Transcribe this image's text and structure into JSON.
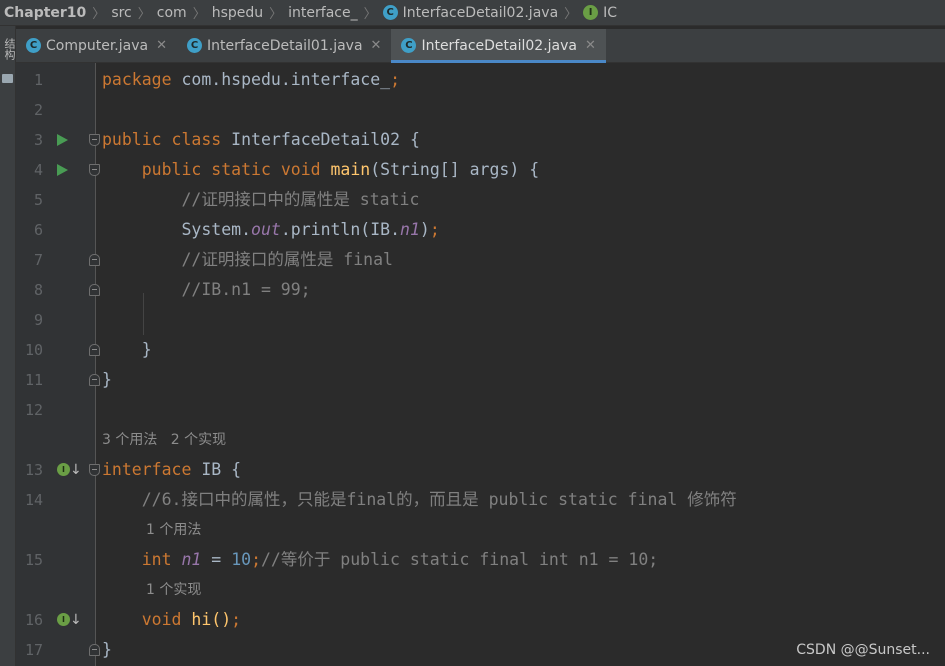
{
  "breadcrumb": [
    "Chapter10",
    "src",
    "com",
    "hspedu",
    "interface_",
    "InterfaceDetail02.java",
    "IC"
  ],
  "strip": {
    "label": "结构"
  },
  "tabs": [
    {
      "label": "Computer.java",
      "active": false
    },
    {
      "label": "InterfaceDetail01.java",
      "active": false
    },
    {
      "label": "InterfaceDetail02.java",
      "active": true
    }
  ],
  "hints": {
    "interface_usages": "3 个用法   2 个实现",
    "field_usages": "1 个用法",
    "method_impls": "1 个实现"
  },
  "lines": {
    "1": {
      "num": "1",
      "kw": "package",
      "rest": " com.hspedu.interface_",
      "semi": ";"
    },
    "2": {
      "num": "2"
    },
    "3": {
      "num": "3",
      "kw": "public class",
      "rest": " InterfaceDetail02 {"
    },
    "4": {
      "num": "4",
      "indent": "    ",
      "kw": "public static void",
      "fn": "main",
      "rest": "(String[] args) {"
    },
    "5": {
      "num": "5",
      "comment": "        //证明接口中的属性是 static"
    },
    "6": {
      "num": "6",
      "a": "        System.",
      "field": "out",
      "b": ".println(IB.",
      "field2": "n1",
      "c": ")",
      "semi": ";"
    },
    "7": {
      "num": "7",
      "comment": "        //证明接口的属性是 final"
    },
    "8": {
      "num": "8",
      "comment": "        //IB.n1 = 99;"
    },
    "9": {
      "num": "9"
    },
    "10": {
      "num": "10",
      "text": "    }"
    },
    "11": {
      "num": "11",
      "text": "}"
    },
    "12": {
      "num": "12"
    },
    "13": {
      "num": "13",
      "kw": "interface",
      "rest": " IB {"
    },
    "14": {
      "num": "14",
      "comment": "    //6.接口中的属性，只能是final的，而且是 public static final 修饰符"
    },
    "15": {
      "num": "15",
      "indent": "    ",
      "kw": "int",
      "field": "n1",
      "eq": " = ",
      "val": "10",
      "semi": ";",
      "comment": "//等价于 public static final int n1 = 10;"
    },
    "16": {
      "num": "16",
      "indent": "    ",
      "kw": "void",
      "rest": " hi()",
      "semi": ";"
    },
    "17": {
      "num": "17",
      "text": "}"
    }
  },
  "watermark": "CSDN @@Sunset...",
  "icons": {
    "class": "C",
    "interface": "I",
    "implemented": "I"
  },
  "colors": {
    "keyword": "#cc7832",
    "function": "#ffc66d",
    "number": "#6897bb",
    "field": "#9876aa",
    "comment": "#808080",
    "text": "#a9b7c6",
    "background": "#2b2b2b",
    "tab_active_underline": "#4a88c7"
  }
}
